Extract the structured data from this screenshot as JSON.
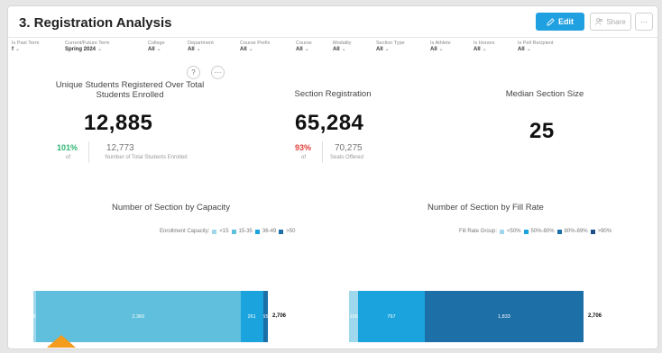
{
  "header": {
    "title": "3. Registration Analysis",
    "edit_label": "Edit",
    "share_label": "Share",
    "more_label": "···"
  },
  "filters": [
    {
      "label": "Is Past Term",
      "value": "f"
    },
    {
      "label": "Current/Future Term",
      "value": "Spring 2024"
    },
    {
      "label": "College",
      "value": "All"
    },
    {
      "label": "Department",
      "value": "All"
    },
    {
      "label": "Course Prefix",
      "value": "All"
    },
    {
      "label": "Course",
      "value": "All"
    },
    {
      "label": "Modality",
      "value": "All"
    },
    {
      "label": "Section Type",
      "value": "All"
    },
    {
      "label": "Is Athlete",
      "value": "All"
    },
    {
      "label": "Is Honors",
      "value": "All"
    },
    {
      "label": "Is Pell Recipient",
      "value": "All"
    }
  ],
  "toolbar": {
    "help_label": "?",
    "options_label": "···"
  },
  "kpi_students": {
    "title": "Unique Students Registered Over Total Students Enrolled",
    "value": "12,885",
    "pct": "101%",
    "pct_of": "of",
    "compare_value": "12,773",
    "compare_label": "Number of Total Students Enrolled"
  },
  "kpi_sections": {
    "title": "Section Registration",
    "value": "65,284",
    "pct": "93%",
    "pct_of": "of",
    "compare_value": "70,275",
    "compare_label": "Seats Offered"
  },
  "kpi_median": {
    "title": "Median Section Size",
    "value": "25"
  },
  "colors": {
    "accent": "#1fa0e0",
    "positive": "#2bb673",
    "negative": "#e0413a",
    "seg1": "#9fd8ec",
    "seg2": "#5fbfdc",
    "seg3": "#1aa3dc",
    "seg4": "#1d6fa8",
    "arrow": "#f39c1d"
  },
  "chart_data": [
    {
      "type": "bar",
      "title": "Number of Section by Capacity",
      "legend_title": "Enrollment Capacity:",
      "legend_position": "top-right",
      "orientation": "horizontal-stacked",
      "series": [
        {
          "name": "<15",
          "value": 30,
          "label": "30",
          "color": "#9fd8ec"
        },
        {
          "name": "15-35",
          "value": 2360,
          "label": "2,360",
          "color": "#5fbfdc"
        },
        {
          "name": "36-49",
          "value": 261,
          "label": "261",
          "color": "#1aa3dc"
        },
        {
          "name": ">50",
          "value": 55,
          "label": "55",
          "color": "#1d6fa8"
        }
      ],
      "total": "2,706"
    },
    {
      "type": "bar",
      "title": "Number of Section by Fill Rate",
      "legend_title": "Fill Rate Group:",
      "legend_position": "top-right",
      "orientation": "horizontal-stacked",
      "series": [
        {
          "name": "<50%",
          "value": 106,
          "label": "106",
          "color": "#9fd8ec"
        },
        {
          "name": "50%-80%",
          "value": 767,
          "label": "767",
          "color": "#1aa3dc"
        },
        {
          "name": "80%-89%",
          "value": 1833,
          "label": "1,833",
          "color": "#1d6fa8"
        },
        {
          "name": ">90%",
          "value": 0,
          "label": "",
          "color": "#1d4f8a"
        }
      ],
      "total": "2,706"
    }
  ]
}
